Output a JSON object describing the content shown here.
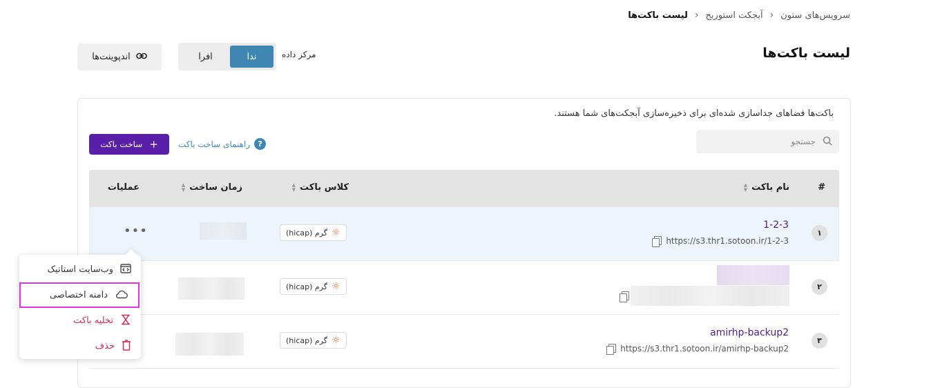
{
  "breadcrumb": {
    "root": "سرویس‌های ستون",
    "section": "آبجکت استوریج",
    "current": "لیست باکت‌ها"
  },
  "page_title": "لیست باکت‌ها",
  "datacenter": {
    "label": "مرکز داده",
    "options": [
      "ندا",
      "افرا"
    ],
    "selected": "ندا"
  },
  "endpoints_label": "اندپوینت‌ها",
  "description": "باکت‌ها فضاهای جداسازی شده‌ای برای ذخیره‌سازی آبجکت‌های شما هستند.",
  "search": {
    "placeholder": "جستجو"
  },
  "guide_label": "راهنمای ساخت باکت",
  "create_label": "ساخت باکت",
  "table": {
    "headers": {
      "index": "#",
      "name": "نام باکت",
      "class": "کلاس باکت",
      "created": "زمان ساخت",
      "actions": "عملیات"
    },
    "rows": [
      {
        "index": "۱",
        "name": "1-2-3",
        "url": "https://s3.thr1.sotoon.ir/1-2-3",
        "class": "گرم (hicap)"
      },
      {
        "index": "۲",
        "name": "",
        "url": "",
        "class": "گرم (hicap)"
      },
      {
        "index": "۳",
        "name": "amirhp-backup2",
        "url": "https://s3.thr1.sotoon.ir/amirhp-backup2",
        "class": "گرم (hicap)"
      }
    ]
  },
  "actions_menu": {
    "items": [
      {
        "label": "وب‌سایت استاتیک",
        "icon": "code-window-icon"
      },
      {
        "label": "دامنه اختصاصی",
        "icon": "cloud-icon"
      },
      {
        "label": "تخلیه باکت",
        "icon": "hourglass-icon"
      },
      {
        "label": "حذف",
        "icon": "trash-icon"
      }
    ]
  },
  "colors": {
    "primary": "#5a1fa8",
    "accent": "#3f87b3",
    "danger": "#d32a54",
    "highlight": "#e233e0"
  }
}
